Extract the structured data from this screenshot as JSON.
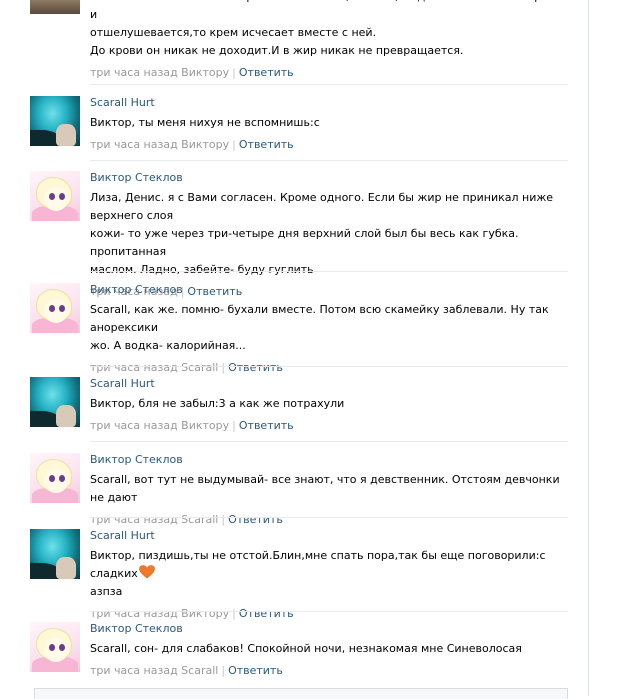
{
  "comments": [
    {
      "author": "",
      "text_lines": [
        "немного впитываются в верхний слой кожи,а потом,когда та же кожа отмирает и",
        "отшелушевается,то крем исчесает вместе с ней.",
        "До крови он никак не доходит.И в жир никак не превращается."
      ],
      "time": "три часа назад Виктору",
      "reply": "Ответить",
      "avatar": "avatar-partial"
    },
    {
      "author": "Scarall Hurt",
      "text_lines": [
        "Виктор, ты меня нихуя не вспомнишь:с"
      ],
      "time": "три часа назад Виктору",
      "reply": "Ответить",
      "avatar": "teal-hair"
    },
    {
      "author": "Виктор Стеклов",
      "text_lines": [
        "Лиза, Денис. я с Вами согласен. Кроме одного. Если бы жир не приникал ниже верхнего слоя",
        "кожи- то уже через три-четыре дня верхний слой был бы весь как губка. пропитанная",
        "маслом. Ладно, забейте- буду гуглить"
      ],
      "time": "три часа назад",
      "reply": "Ответить",
      "avatar": "pony"
    },
    {
      "author": "Виктор Стеклов",
      "text_lines": [
        "Scarall, как же. помню- бухали вместе. Потом всю скамейку заблевали. Ну так анорексики",
        "жо. А водка- калорийная..."
      ],
      "time": "три часа назад Scarall",
      "reply": "Ответить",
      "avatar": "pony"
    },
    {
      "author": "Scarall Hurt",
      "text_lines": [
        "Виктор, бля не забыл:3 а как же потрахули"
      ],
      "time": "три часа назад Виктору",
      "reply": "Ответить",
      "avatar": "teal-hair"
    },
    {
      "author": "Виктор Стеклов",
      "text_lines": [
        "Scarall, вот тут не выдумывай- все знают, что я девственник. Отстоям девчонки не дают"
      ],
      "time": "три часа назад Scarall",
      "reply": "Ответить",
      "avatar": "pony"
    },
    {
      "author": "Scarall Hurt",
      "text_lines": [
        "Виктор, пиздишь,ты не отстой.Блин,мне спать пора,так бы еще поговорили:с сладких",
        "азпза"
      ],
      "time": "три часа назад Виктору",
      "reply": "Ответить",
      "avatar": "teal-hair",
      "emoji": "orange-heart-icon"
    },
    {
      "author": "Виктор Стеклов",
      "text_lines": [
        "Scarall, сон- для слабаков! Спокойной ночи, незнакомая мне Синеволосая"
      ],
      "time": "три часа назад Scarall",
      "reply": "Ответить",
      "avatar": "pony"
    }
  ],
  "colors": {
    "link": "#2b587a",
    "meta": "#999999",
    "heart": "#f07a2a"
  }
}
